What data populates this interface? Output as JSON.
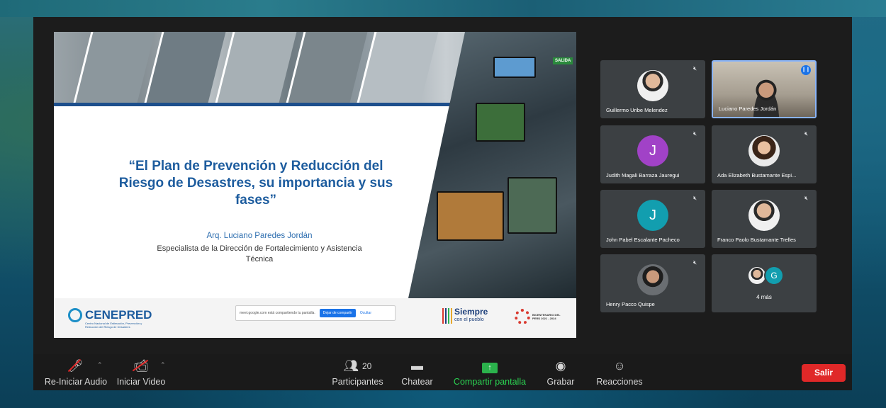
{
  "slide": {
    "title": "“El Plan de Prevención y Reducción del Riesgo de Desastres, su importancia y sus fases”",
    "author": "Arq. Luciano Paredes Jordán",
    "role": "Especialista de la Dirección de Fortalecimiento y Asistencia Técnica",
    "logo": "CENEPRED",
    "logo_sub": "Centro Nacional de Estimación, Prevención y Reducción del Riesgo de Desastres",
    "share_notice": "meet.google.com está compartiendo tu pantalla.",
    "share_stop": "Dejar de compartir",
    "share_hide": "Ocultar",
    "siempre": "Siempre",
    "siempre_sub": "con el pueblo",
    "bicentenario": "BICENTENARIO DEL PERÚ 2021 - 2024",
    "sign": "SALIDA"
  },
  "participants": [
    {
      "name": "Guillermo Uribe Melendez",
      "muted": true,
      "avatar": "photo"
    },
    {
      "name": "Luciano Paredes Jordán",
      "muted": false,
      "speaking": true,
      "avatar": "video"
    },
    {
      "name": "Judith Magali Barraza Jauregui",
      "muted": true,
      "initial": "J",
      "color": "#a142c7"
    },
    {
      "name": "Ada Elizabeth Bustamante Espi...",
      "muted": true,
      "avatar": "photo"
    },
    {
      "name": "John Pabel Escalante Pacheco",
      "muted": true,
      "initial": "J",
      "color": "#129eaf"
    },
    {
      "name": "Franco Paolo Bustamante Trelles",
      "muted": true,
      "avatar": "photo"
    },
    {
      "name": "Henry Pacco Quispe",
      "muted": true,
      "avatar": "photo"
    }
  ],
  "more": {
    "label": "4 más",
    "initial": "G",
    "color": "#129eaf"
  },
  "toolbar": {
    "audio": "Re-Iniciar Audio",
    "video": "Iniciar Video",
    "participants_count": "20",
    "participants": "Participantes",
    "chat": "Chatear",
    "share": "Compartir pantalla",
    "record": "Grabar",
    "reactions": "Reacciones",
    "exit": "Salir"
  },
  "colors": {
    "accent": "#1a73e8",
    "share_green": "#2bb24c",
    "exit_red": "#e02828",
    "slide_title": "#1d5c9e"
  }
}
